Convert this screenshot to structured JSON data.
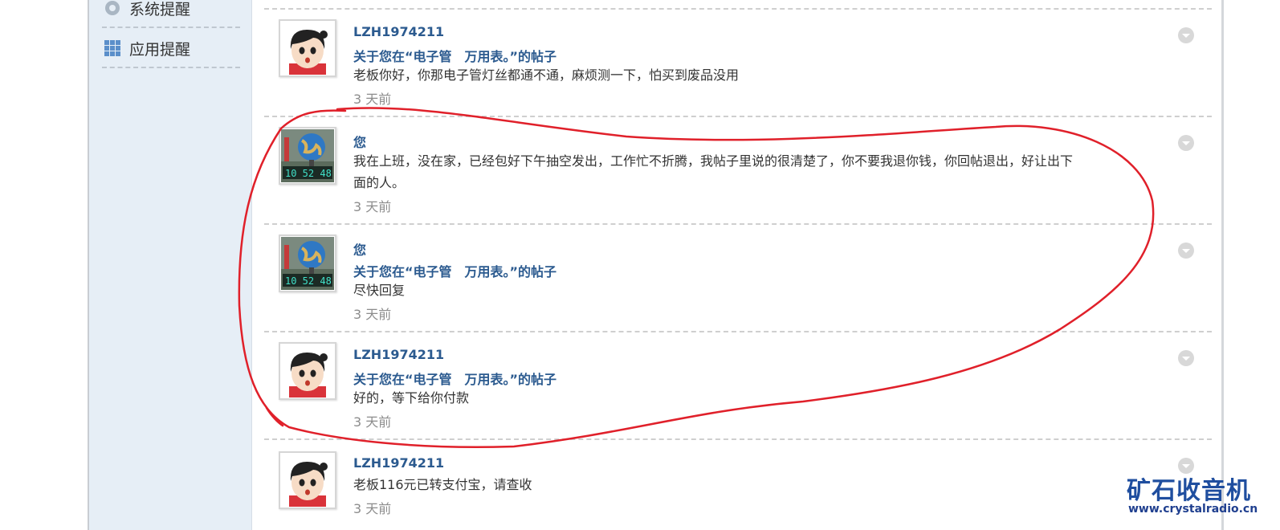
{
  "sidebar": {
    "items": [
      {
        "label": "系统提醒",
        "icon": "gear-icon"
      },
      {
        "label": "应用提醒",
        "icon": "apps-grid-icon"
      }
    ]
  },
  "notifications": [
    {
      "user": "LZH1974211",
      "thread": "关于您在“电子管　万用表。”的帖子",
      "message": "老板你好，你那电子管灯丝都通不通，麻烦测一下，怕买到废品没用",
      "time": "3 天前",
      "avatar": "cartoon-boy"
    },
    {
      "user": "您",
      "thread": "",
      "message": "我在上班，没在家，已经包好下午抽空发出，工作忙不折腾，我帖子里说的很清楚了，你不要我退你钱，你回帖退出，好让出下面的人。",
      "time": "3 天前",
      "avatar": "globe-clock"
    },
    {
      "user": "您",
      "thread": "关于您在“电子管　万用表。”的帖子",
      "message": "尽快回复",
      "time": "3 天前",
      "avatar": "globe-clock"
    },
    {
      "user": "LZH1974211",
      "thread": "关于您在“电子管　万用表。”的帖子",
      "message": "好的，等下给你付款",
      "time": "3 天前",
      "avatar": "cartoon-boy"
    },
    {
      "user": "LZH1974211",
      "thread": "",
      "message": "老板116元已转支付宝，请查收",
      "time": "3 天前",
      "avatar": "cartoon-boy"
    }
  ],
  "watermark": {
    "title": "矿石收音机",
    "url": "www.crystalradio.cn"
  },
  "colors": {
    "link": "#2b5a8f",
    "annotation": "#e0202a",
    "sidebar_bg": "#e6eef6"
  }
}
